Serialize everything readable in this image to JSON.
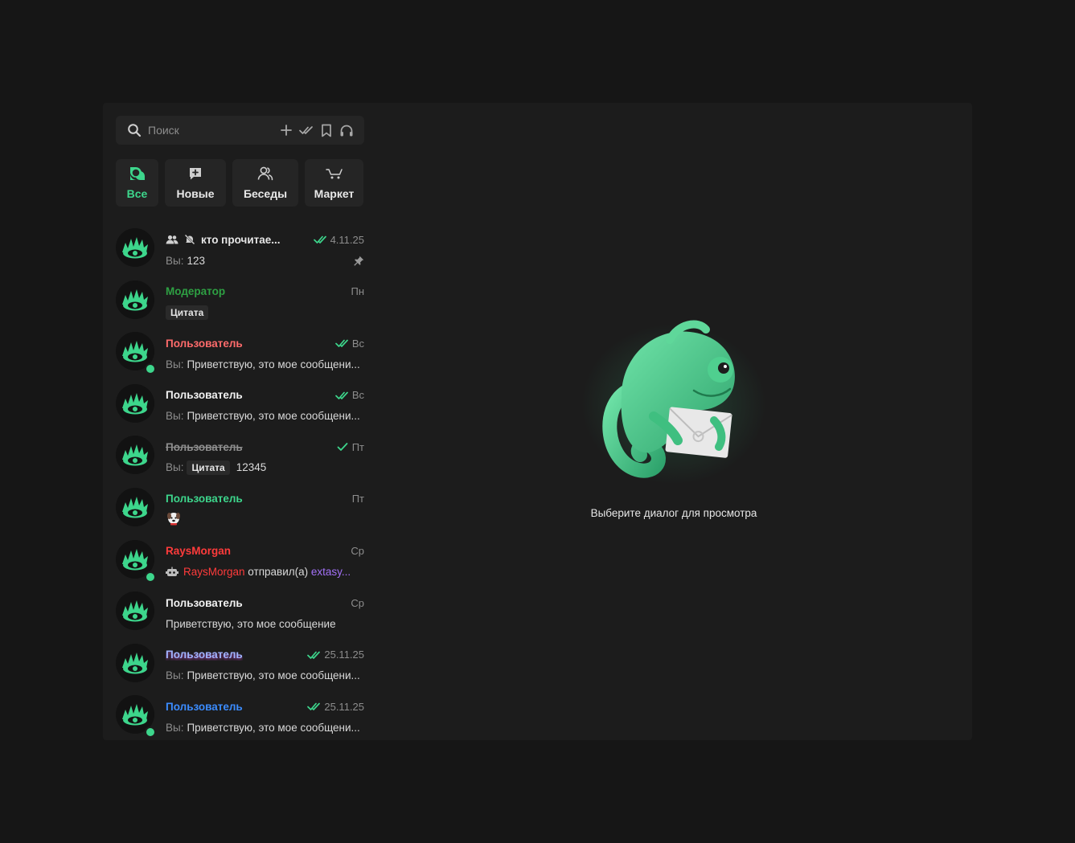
{
  "search": {
    "placeholder": "Поиск"
  },
  "tabs": [
    {
      "label": "Все",
      "icon": "chat-bubbles-icon",
      "active": true
    },
    {
      "label": "Новые",
      "icon": "new-chat-icon"
    },
    {
      "label": "Беседы",
      "icon": "group-icon"
    },
    {
      "label": "Маркет",
      "icon": "cart-icon"
    }
  ],
  "chats": [
    {
      "name": "кто прочитае...",
      "name_color": "#e6e6e6",
      "time": "4.11.25",
      "you": "Вы:",
      "preview": "123",
      "read": true,
      "pinned": true,
      "group": true,
      "muted": true
    },
    {
      "name": "Модератор",
      "name_color": "#2ea043",
      "time": "Пн",
      "quote": "Цитата"
    },
    {
      "name": "Пользователь",
      "name_color": "#ff6b6b",
      "time": "Вс",
      "you": "Вы:",
      "preview": "Приветствую, это мое сообщени...",
      "read": true,
      "online": true
    },
    {
      "name": "Пользователь",
      "name_color": "#f2f2f2",
      "time": "Вс",
      "you": "Вы:",
      "preview": "Приветствую, это мое сообщени...",
      "read": true
    },
    {
      "name": "Пользователь",
      "name_color": "#8d8d8d",
      "time": "Пт",
      "you": "Вы:",
      "quote": "Цитата",
      "preview": "12345",
      "read": true,
      "sent": true
    },
    {
      "name": "Пользователь",
      "name_color": "#3dd68c",
      "time": "Пт",
      "sticker": "dog-sticker-icon"
    },
    {
      "name": "RaysMorgan",
      "name_color": "#ff3b3b",
      "time": "Ср",
      "bot_name": "RaysMorgan",
      "bot_action": "отправил(а)",
      "bot_target": "extasy...",
      "online": true
    },
    {
      "name": "Пользователь",
      "name_color": "#f2f2f2",
      "time": "Ср",
      "preview": "Приветствую, это мое сообщение"
    },
    {
      "name": "Пользователь",
      "name_color": "#9fb4ff",
      "time": "25.11.25",
      "you": "Вы:",
      "preview": "Приветствую, это мое сообщени...",
      "read": true
    },
    {
      "name": "Пользователь",
      "name_color": "#3b8cff",
      "time": "25.11.25",
      "you": "Вы:",
      "preview": "Приветствую, это мое сообщени...",
      "read": true,
      "online": true
    }
  ],
  "empty_state": {
    "text": "Выберите диалог для просмотра",
    "illustration": "chameleon-with-envelope"
  },
  "colors": {
    "accent": "#3dd68c",
    "background": "#161616",
    "panel": "#1c1c1c",
    "muted": "#8d8d8d",
    "bot_target": "#a371f7"
  }
}
